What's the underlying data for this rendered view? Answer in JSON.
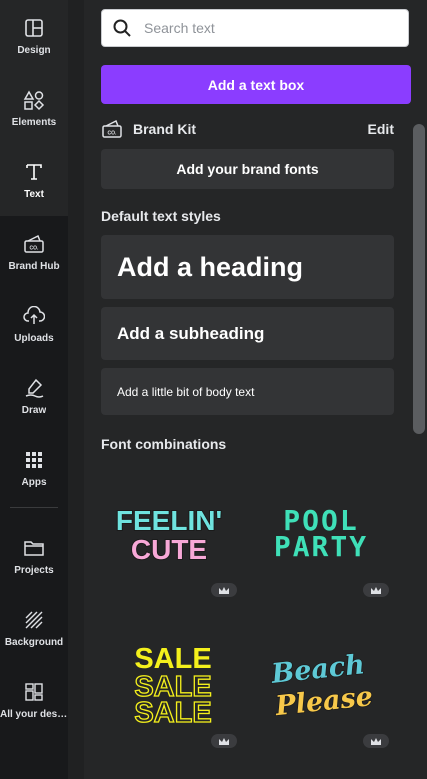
{
  "rail": {
    "items": [
      {
        "label": "Design",
        "icon": "layout-icon"
      },
      {
        "label": "Elements",
        "icon": "shapes-icon"
      },
      {
        "label": "Text",
        "icon": "text-icon"
      },
      {
        "label": "Brand Hub",
        "icon": "brand-hub-icon"
      },
      {
        "label": "Uploads",
        "icon": "cloud-upload-icon"
      },
      {
        "label": "Draw",
        "icon": "draw-icon"
      },
      {
        "label": "Apps",
        "icon": "apps-grid-icon"
      },
      {
        "label": "Projects",
        "icon": "folder-icon"
      },
      {
        "label": "Background",
        "icon": "background-hatch-icon"
      },
      {
        "label": "All your desi…",
        "icon": "all-designs-icon"
      }
    ]
  },
  "panel": {
    "search": {
      "placeholder": "Search text",
      "value": ""
    },
    "add_text_box": "Add a text box",
    "brand_kit": {
      "title": "Brand Kit",
      "edit": "Edit",
      "add_fonts": "Add your brand fonts"
    },
    "default_styles": {
      "title": "Default text styles",
      "heading": "Add a heading",
      "subheading": "Add a subheading",
      "body": "Add a little bit of body text"
    },
    "font_combinations": {
      "title": "Font combinations",
      "items": [
        {
          "lines": [
            "FEELIN'",
            "CUTE"
          ],
          "pro": true
        },
        {
          "lines": [
            "POOL",
            "PARTY"
          ],
          "pro": true
        },
        {
          "lines": [
            "SALE",
            "SALE",
            "SALE"
          ],
          "pro": true
        },
        {
          "lines": [
            "Beach",
            "Please"
          ],
          "pro": true
        }
      ]
    }
  },
  "colors": {
    "accent": "#8b3dff",
    "panel_bg": "#252627",
    "rail_bg": "#18191b",
    "card_bg": "#333436"
  }
}
